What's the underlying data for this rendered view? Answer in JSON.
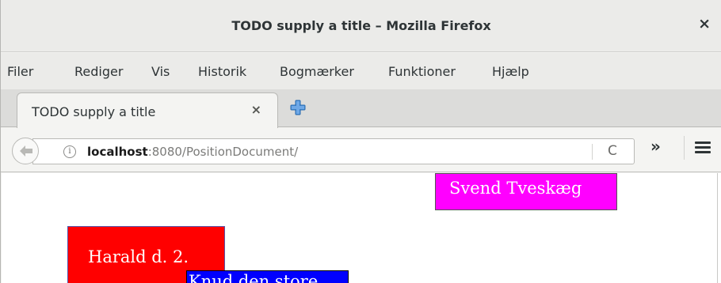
{
  "window": {
    "title": "TODO supply a title – Mozilla Firefox",
    "close_glyph": "×"
  },
  "menu": {
    "items": [
      "Filer",
      "Rediger",
      "Vis",
      "Historik",
      "Bogmærker",
      "Funktioner",
      "Hjælp"
    ]
  },
  "tabs": [
    {
      "title": "TODO supply a title",
      "close_glyph": "×"
    }
  ],
  "navbar": {
    "url_host": "localhost",
    "url_rest": ":8080/PositionDocument/",
    "info_glyph": "i",
    "reload_glyph": "C",
    "overflow_glyph": "»",
    "back_icon": "back-arrow-icon",
    "menu_icon": "hamburger-menu-icon",
    "new_tab_icon": "plus-icon"
  },
  "page": {
    "boxes": [
      {
        "label": "Svend Tveskæg",
        "color": "#ff00ff"
      },
      {
        "label": "Harald d. 2.",
        "color": "#ff0000"
      },
      {
        "label": "Knud den store",
        "color": "#0000ff"
      }
    ]
  },
  "colors": {
    "new_tab_accent": "#4a90d9"
  }
}
